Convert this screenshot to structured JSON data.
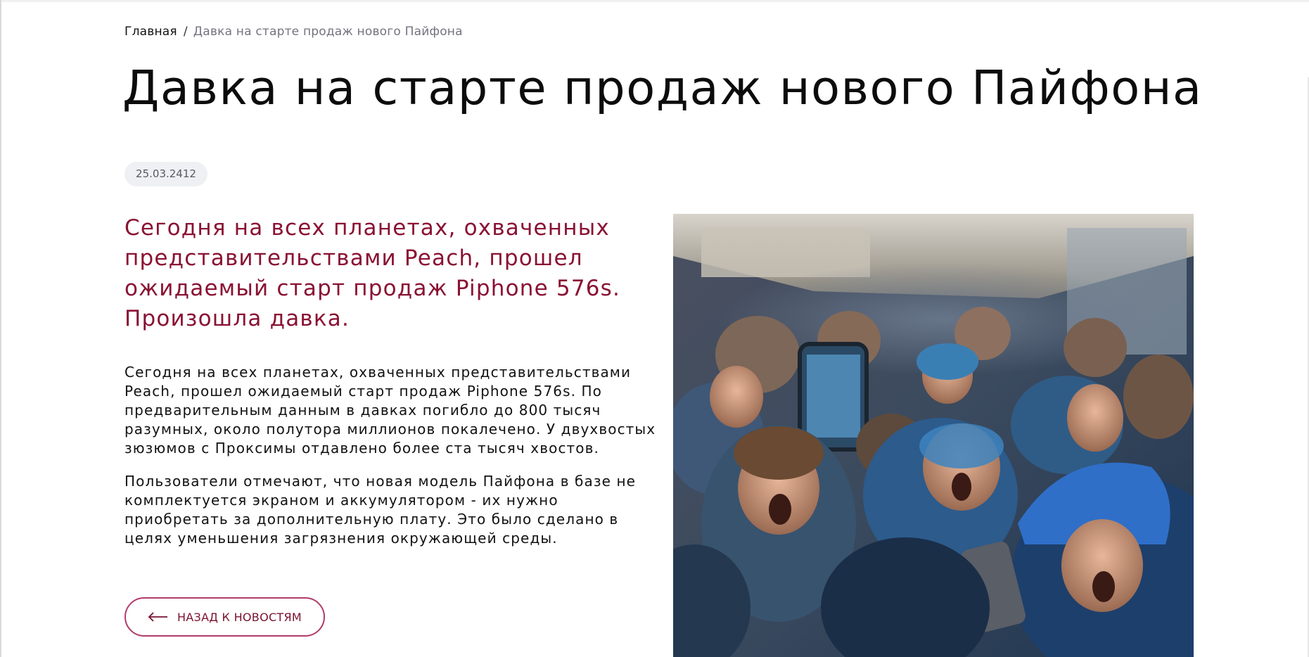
{
  "breadcrumb": {
    "home": "Главная",
    "separator": "/",
    "current": "Давка на старте продаж нового Пайфона"
  },
  "article": {
    "title": "Давка на старте продаж нового Пайфона",
    "date": "25.03.2412",
    "lead": "Сегодня на всех планетах, охваченных представительствами Peach, прошел ожидаемый старт продаж Piphone 576s. Произошла давка.",
    "paragraphs": [
      "Сегодня на всех планетах, охваченных представительствами Peach, прошел ожидаемый старт продаж Piphone 576s. По предварительным данным в давках погибло до 800 тысяч разумных, около полутора миллионов покалечено. У двухвостых зюзюмов с Проксимы отдавлено более ста тысяч хвостов.",
      "Пользователи отмечают, что новая модель Пайфона в базе не комплектуется экраном и аккумулятором - их нужно приобретать за дополнительную плату. Это было сделано в целях уменьшения загрязнения окружающей среды."
    ],
    "image_icon": "crowd-photo"
  },
  "back_button": {
    "label": "НАЗАД К НОВОСТЯМ",
    "icon": "arrow-left-icon"
  },
  "colors": {
    "accent": "#8a1233",
    "button_border": "#b23b6b",
    "badge_bg": "#eef0f3"
  }
}
